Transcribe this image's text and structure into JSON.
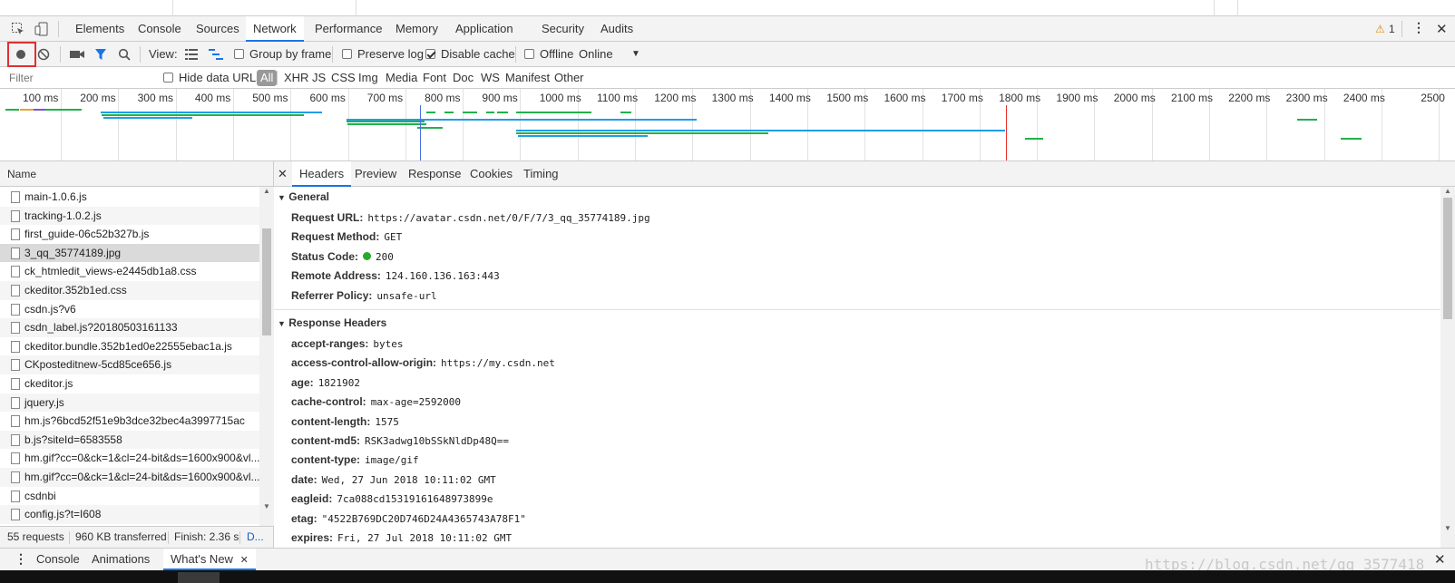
{
  "main_tabs": [
    "Elements",
    "Console",
    "Sources",
    "Network",
    "Performance",
    "Memory",
    "Application",
    "Security",
    "Audits"
  ],
  "active_main_tab": "Network",
  "warning_count": "1",
  "toolbar": {
    "view_label": "View:",
    "group_by_frame": "Group by frame",
    "preserve_log": "Preserve log",
    "disable_cache": "Disable cache",
    "offline": "Offline",
    "throttle": "Online"
  },
  "filter": {
    "placeholder": "Filter",
    "hide_data_urls": "Hide data URLs",
    "types": [
      "All",
      "XHR",
      "JS",
      "CSS",
      "Img",
      "Media",
      "Font",
      "Doc",
      "WS",
      "Manifest",
      "Other"
    ]
  },
  "timeline": {
    "ticks": [
      "100 ms",
      "200 ms",
      "300 ms",
      "400 ms",
      "500 ms",
      "600 ms",
      "700 ms",
      "800 ms",
      "900 ms",
      "1000 ms",
      "1100 ms",
      "1200 ms",
      "1300 ms",
      "1400 ms",
      "1500 ms",
      "1600 ms",
      "1700 ms",
      "1800 ms",
      "1900 ms",
      "2000 ms",
      "2100 ms",
      "2200 ms",
      "2300 ms",
      "2400 ms",
      "2500"
    ],
    "colors": {
      "blue": "#1e9ee8",
      "green": "#22b14c",
      "red": "#e8332d",
      "purple": "#7b56c9",
      "orange": "#e8a334"
    }
  },
  "name_column": {
    "header": "Name",
    "rows": [
      "main-1.0.6.js",
      "tracking-1.0.2.js",
      "first_guide-06c52b327b.js",
      "3_qq_35774189.jpg",
      "ck_htmledit_views-e2445db1a8.css",
      "ckeditor.352b1ed.css",
      "csdn.js?v6",
      "csdn_label.js?20180503161133",
      "ckeditor.bundle.352b1ed0e22555ebac1a.js",
      "CKposteditnew-5cd85ce656.js",
      "ckeditor.js",
      "jquery.js",
      "hm.js?6bcd52f51e9b3dce32bec4a3997715ac",
      "b.js?siteId=6583558",
      "hm.gif?cc=0&ck=1&cl=24-bit&ds=1600x900&vl...",
      "hm.gif?cc=0&ck=1&cl=24-bit&ds=1600x900&vl...",
      "csdnbi",
      "config.js?t=I608"
    ],
    "selected": "3_qq_35774189.jpg"
  },
  "summary": {
    "requests": "55 requests",
    "transferred": "960 KB transferred",
    "finish": "Finish: 2.36 s",
    "dom": "D..."
  },
  "detail_tabs": [
    "Headers",
    "Preview",
    "Response",
    "Cookies",
    "Timing"
  ],
  "active_detail_tab": "Headers",
  "general": {
    "title": "General",
    "rows": [
      {
        "key": "Request URL:",
        "value": "https://avatar.csdn.net/0/F/7/3_qq_35774189.jpg"
      },
      {
        "key": "Request Method:",
        "value": "GET"
      },
      {
        "key": "Status Code:",
        "value": "200"
      },
      {
        "key": "Remote Address:",
        "value": "124.160.136.163:443"
      },
      {
        "key": "Referrer Policy:",
        "value": "unsafe-url"
      }
    ],
    "status_color": "#2aa82a"
  },
  "response_headers": {
    "title": "Response Headers",
    "rows": [
      {
        "key": "accept-ranges:",
        "value": "bytes"
      },
      {
        "key": "access-control-allow-origin:",
        "value": "https://my.csdn.net"
      },
      {
        "key": "age:",
        "value": "1821902"
      },
      {
        "key": "cache-control:",
        "value": "max-age=2592000"
      },
      {
        "key": "content-length:",
        "value": "1575"
      },
      {
        "key": "content-md5:",
        "value": "RSK3adwg10bSSkNldDp48Q=="
      },
      {
        "key": "content-type:",
        "value": "image/gif"
      },
      {
        "key": "date:",
        "value": "Wed, 27 Jun 2018 10:11:02 GMT"
      },
      {
        "key": "eagleid:",
        "value": "7ca088cd15319161648973899e"
      },
      {
        "key": "etag:",
        "value": "\"4522B769DC20D746D24A4365743A78F1\""
      },
      {
        "key": "expires:",
        "value": "Fri, 27 Jul 2018 10:11:02 GMT"
      }
    ]
  },
  "drawer": {
    "tabs": [
      "Console",
      "Animations",
      "What's New"
    ],
    "active": "What's New"
  },
  "watermark": "https://blog.csdn.net/qq_3577418"
}
